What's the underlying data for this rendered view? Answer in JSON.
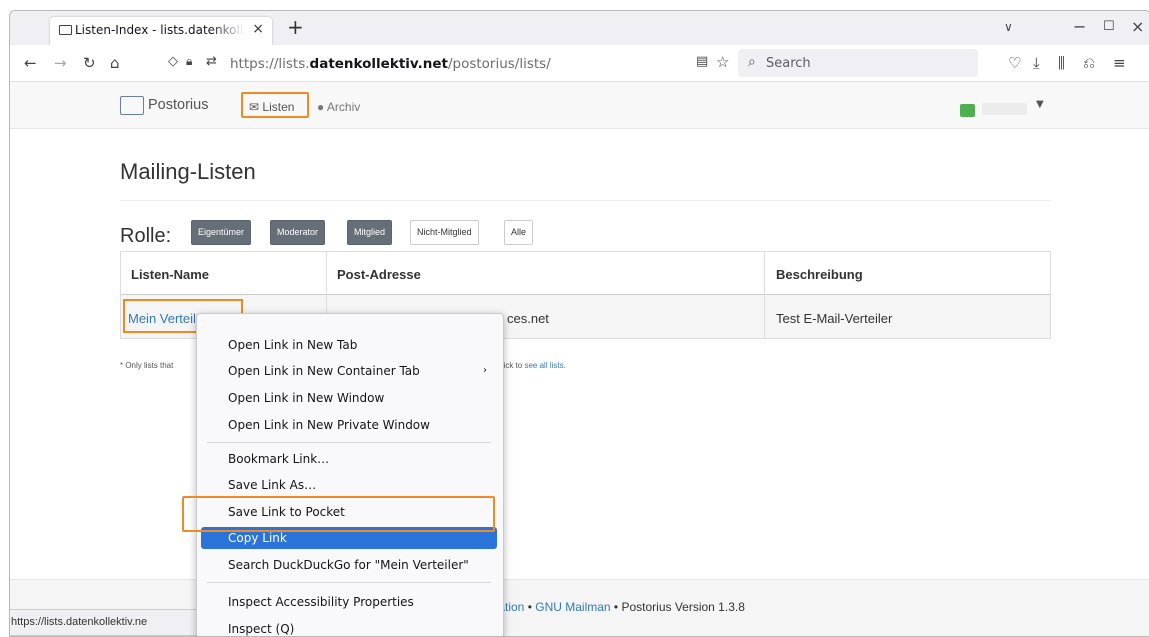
{
  "browser": {
    "tab_title": "Listen-Index - lists.datenkollektiv.net",
    "url_prefix": "https://lists.",
    "url_domain": "datenkollektiv.net",
    "url_path": "/postorius/lists/",
    "search_placeholder": "Search",
    "status_url": "https://lists.datenkollektiv.ne"
  },
  "site": {
    "brand": "Postorius",
    "nav_listen": "Listen",
    "nav_archiv": "Archiv"
  },
  "page": {
    "title": "Mailing-Listen",
    "role_label": "Rolle:",
    "roles": [
      "Eigentümer",
      "Moderator",
      "Mitglied",
      "Nicht-Mitglied",
      "Alle"
    ],
    "columns": [
      "Listen-Name",
      "Post-Adresse",
      "Beschreibung"
    ],
    "rows": [
      {
        "name": "Mein Verteiler",
        "address_tail": "ces.net",
        "description": "Test E-Mail-Verteiler"
      }
    ],
    "note_start": "* Only lists that",
    "note_mid": "Click to",
    "note_link": "see all lists",
    "note_end": "."
  },
  "footer": {
    "doc_fragment": "tation",
    "mailman": "GNU Mailman",
    "version": "Postorius Version 1.3.8"
  },
  "context_menu": {
    "items": [
      "Open Link in New Tab",
      "Open Link in New Container Tab",
      "Open Link in New Window",
      "Open Link in New Private Window",
      "Bookmark Link…",
      "Save Link As…",
      "Save Link to Pocket",
      "Copy Link",
      "Search DuckDuckGo for \"Mein Verteiler\"",
      "Inspect Accessibility Properties",
      "Inspect (Q)"
    ]
  },
  "colors": {
    "highlight": "#2a73d9",
    "annotation": "#f08a24",
    "link": "#337ab7"
  }
}
